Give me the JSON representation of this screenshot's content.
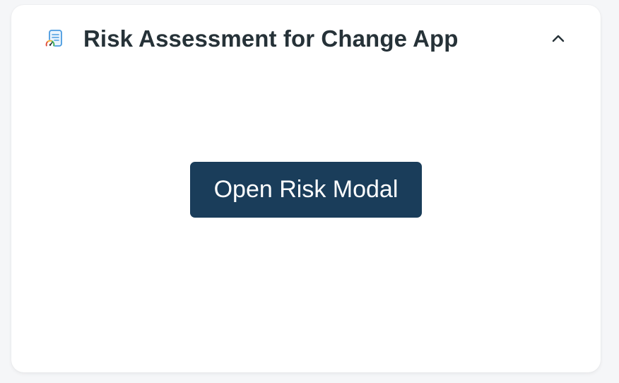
{
  "panel": {
    "title": "Risk Assessment for Change App",
    "app_icon": "risk-gauge-document-icon",
    "collapse_icon": "chevron-up-icon"
  },
  "actions": {
    "open_modal_label": "Open Risk Modal"
  },
  "colors": {
    "button_bg": "#1a3d5a",
    "title_text": "#263238",
    "page_bg": "#f5f6f8",
    "card_bg": "#ffffff"
  }
}
